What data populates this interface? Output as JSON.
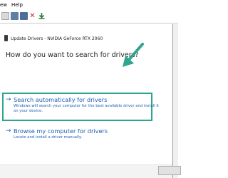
{
  "menubar": {
    "view_label": "ew",
    "help_label": "Help"
  },
  "dialog": {
    "header": "Update Drivers - NVIDIA GeForce RTX 2060",
    "question": "How do you want to search for drivers?",
    "options": [
      {
        "title": "Search automatically for drivers",
        "description": "Windows will search your computer for the best available driver and install it on your device."
      },
      {
        "title": "Browse my computer for drivers",
        "description": "Locate and install a driver manually."
      }
    ]
  },
  "colors": {
    "link": "#1a5fb4",
    "highlight": "#2ea58e"
  }
}
